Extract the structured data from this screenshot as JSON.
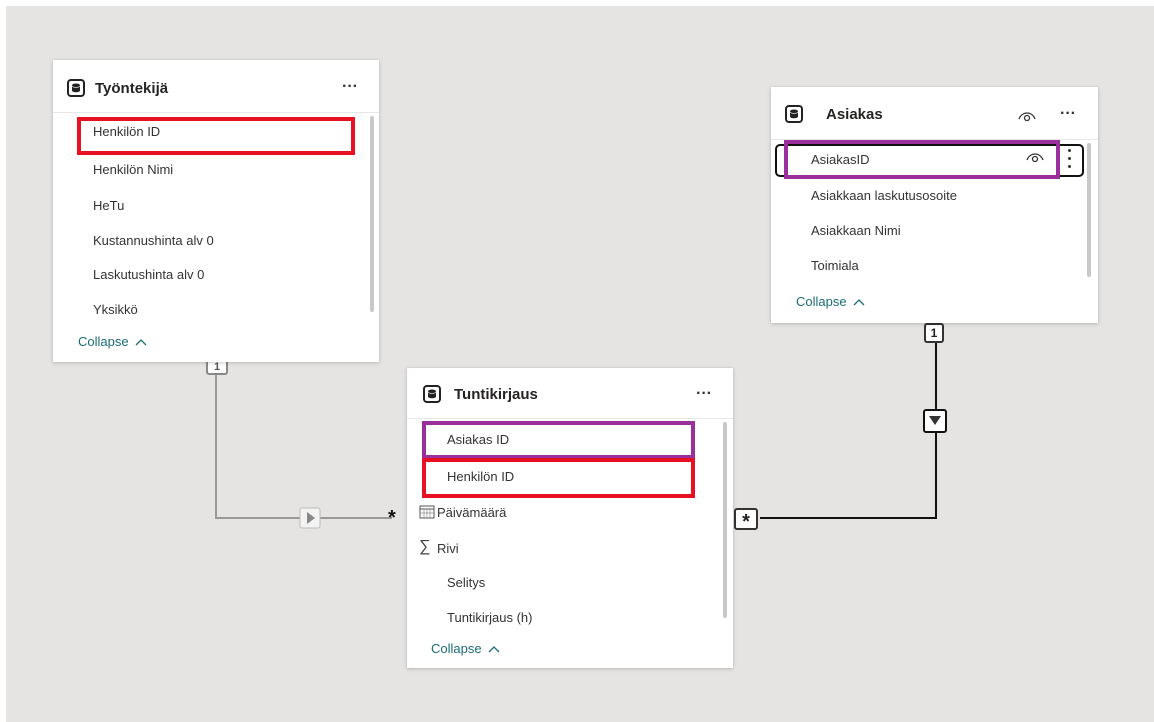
{
  "tables": {
    "tyontekija": {
      "title": "Työntekijä",
      "more": "···",
      "fields": [
        "Henkilön ID",
        "Henkilön Nimi",
        "HeTu",
        "Kustannushinta alv 0",
        "Laskutushinta alv 0",
        "Yksikkö"
      ],
      "collapse": "Collapse"
    },
    "asiakas": {
      "title": "Asiakas",
      "more": "···",
      "fields": [
        "AsiakasID",
        "Asiakkaan laskutusosoite",
        "Asiakkaan Nimi",
        "Toimiala"
      ],
      "collapse": "Collapse"
    },
    "tuntikirjaus": {
      "title": "Tuntikirjaus",
      "more": "···",
      "fields": [
        "Asiakas ID",
        "Henkilön ID",
        "Päivämäärä",
        "Rivi",
        "Selitys",
        "Tuntikirjaus (h)"
      ],
      "collapse": "Collapse"
    }
  },
  "relationships": {
    "tyontekija_one": "1",
    "asiakas_one": "1",
    "many_symbol": "*"
  },
  "colors": {
    "canvas": "#e5e4e2",
    "highlight_red": "#e81123",
    "highlight_purple": "#9b2f9b",
    "collapse_link": "#1b6b77"
  },
  "icons": {
    "table": "table-icon",
    "more": "more-options-icon",
    "eye": "eye-visibility-icon",
    "calendar": "calendar-icon",
    "sum": "sigma-icon",
    "chevron": "chevron-up-icon"
  }
}
